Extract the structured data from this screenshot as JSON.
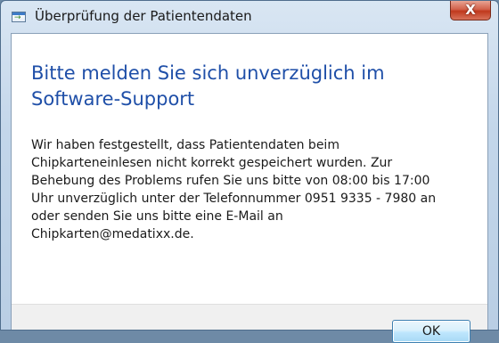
{
  "window": {
    "title": "Überprüfung der Patientendaten",
    "close_glyph": "X"
  },
  "dialog": {
    "headline_lines": [
      "Bitte melden Sie sich unverzüglich im",
      "Software-Support"
    ],
    "message_lines": [
      "Wir haben festgestellt, dass Patientendaten beim",
      "Chipkarteneinlesen nicht korrekt gespeichert wurden. Zur",
      "Behebung des Problems rufen Sie uns bitte von 08:00 bis 17:00",
      "Uhr unverzüglich unter der Telefonnummer 0951 9335 - 7980 an",
      "oder senden Sie uns bitte eine E-Mail an",
      "Chipkarten@medatixx.de."
    ],
    "ok_label": "OK"
  },
  "colors": {
    "headline": "#1f4fa8",
    "close_button": "#c0391d",
    "ok_button_border": "#3c7fb1"
  },
  "icons": {
    "title": "app-window-icon",
    "close": "close-icon"
  }
}
